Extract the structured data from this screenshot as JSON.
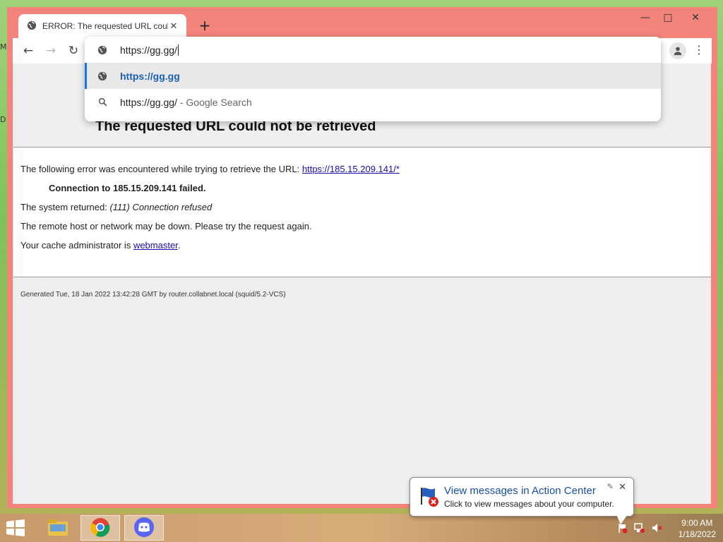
{
  "desktop": {
    "edge_labels": [
      "M",
      "D"
    ]
  },
  "browser": {
    "tab": {
      "title": "ERROR: The requested URL could not be retrieved",
      "close_glyph": "✕"
    },
    "new_tab_glyph": "+",
    "window_controls": {
      "minimize": "—",
      "maximize": "□",
      "close": "✕"
    },
    "nav": {
      "back": "←",
      "forward": "→",
      "reload": "↻"
    },
    "menu_glyph": "⋮",
    "omnibox": {
      "value": "https://gg.gg/",
      "suggestions": [
        {
          "text": "https://gg.gg",
          "icon": "globe-icon"
        },
        {
          "text": "https://gg.gg/",
          "suffix": " - Google Search",
          "icon": "search-icon"
        }
      ]
    }
  },
  "page": {
    "title": "The requested URL could not be retrieved",
    "line1_prefix": "The following error was encountered while trying to retrieve the URL: ",
    "line1_link": "https://185.15.209.141/*",
    "line2": "Connection to 185.15.209.141 failed.",
    "line3_prefix": "The system returned: ",
    "line3_italic": "(111) Connection refused",
    "line4": "The remote host or network may be down. Please try the request again.",
    "line5_prefix": "Your cache administrator is ",
    "line5_link": "webmaster",
    "line5_suffix": ".",
    "footer": "Generated Tue, 18 Jan 2022 13:42:28 GMT by router.collabnet.local (squid/5.2-VCS)"
  },
  "balloon": {
    "title": "View messages in Action Center",
    "text": "Click to view messages about your computer.",
    "close_glyph": "✕",
    "pin_glyph": "✎"
  },
  "taskbar": {
    "clock_time": "9:00 AM",
    "clock_date": "1/18/2022"
  },
  "colors": {
    "window_frame": "#f2847c",
    "link": "#1a0dab",
    "accent": "#1a73e8"
  }
}
